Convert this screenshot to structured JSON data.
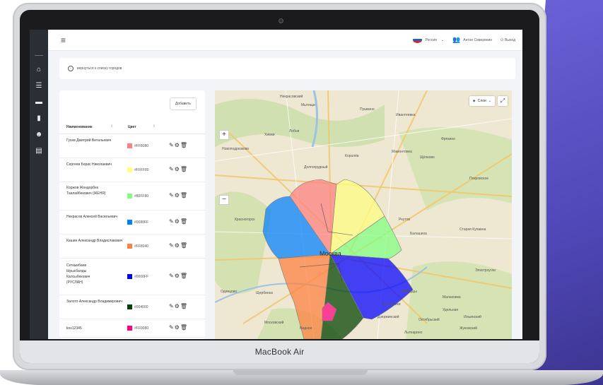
{
  "device": {
    "brand": "MacBook Air"
  },
  "topbar": {
    "menu_icon": "hamburger-icon",
    "language": "Россия",
    "user_name": "Антон Северянин",
    "logout_label": "Выход"
  },
  "sidebar": {
    "icons": [
      "home-icon",
      "list-icon",
      "car-icon",
      "chart-icon",
      "users-icon",
      "document-icon"
    ]
  },
  "breadcrumb": {
    "text": "вернуться к списку городов"
  },
  "table": {
    "add_label": "Добавить",
    "columns": [
      "Наименование",
      "Цвет"
    ],
    "rows": [
      {
        "name": "Гусев Дмитрий Витальевич",
        "color": "#FF8080",
        "hex": "#FF8080"
      },
      {
        "name": "Сергеев Борис Николаевич",
        "color": "#FFFF80",
        "hex": "#FFFF80"
      },
      {
        "name": "Коржов Жондорбек Таалайбекович (ЖЕНЯ)",
        "color": "#80FF80",
        "hex": "#80FF80"
      },
      {
        "name": "Некрасов Алексей Васильевич",
        "color": "#0080FF",
        "hex": "#0080FF"
      },
      {
        "name": "Кашин Александр Владиславович",
        "color": "#FF8040",
        "hex": "#FF8040"
      },
      {
        "name": "Сеткыибаев Ырысбалды Калсыбекович (РУСЛАН)",
        "color": "#0000FF",
        "hex": "#0000FF"
      },
      {
        "name": "Залото Александр Владимирович",
        "color": "#004000",
        "hex": "#004000"
      },
      {
        "name": "kos12345",
        "color": "#FF0080",
        "hex": "#FF0080"
      }
    ]
  },
  "map": {
    "layers_label": "Слои",
    "city_label": "Москва",
    "labels": [
      "Некрасовский",
      "Мытищи",
      "Пушкино",
      "Ивантеевка",
      "Фрязино",
      "Щёлково",
      "Королёв",
      "Лобня",
      "Красногорск",
      "Реутов",
      "Балашиха",
      "Люберцы",
      "Котельники",
      "Видное",
      "Дзержинский",
      "Одинцово",
      "Электроугли",
      "Старая Купавна",
      "Щербинка",
      "Химки",
      "Долгопрудный",
      "Московский",
      "Удельная",
      "Ильинский",
      "Жуковский",
      "Октябрьский",
      "Лыткарино",
      "Мамонтовка",
      "Новоподрезково",
      "Малаховка",
      "Покровское"
    ]
  }
}
